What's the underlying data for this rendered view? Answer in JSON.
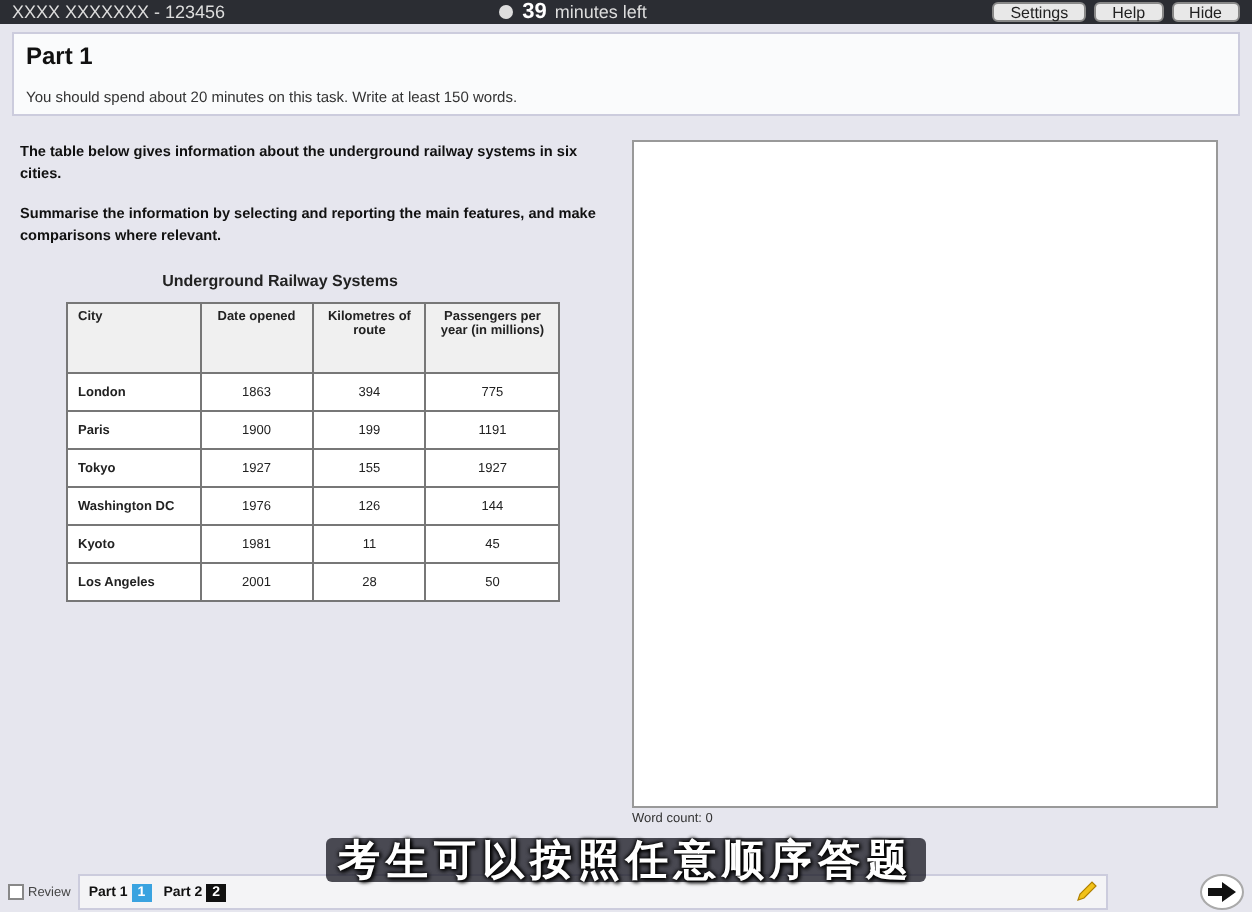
{
  "top_bar": {
    "candidate": "XXXX XXXXXXX - 123456",
    "time_value": "39",
    "time_label": "minutes left",
    "buttons": [
      "Settings",
      "Help",
      "Hide"
    ]
  },
  "header": {
    "title": "Part 1",
    "instruction": "You should spend about 20 minutes on this task. Write at least 150 words."
  },
  "prompt": [
    "The table below gives information about the underground railway systems in six cities.",
    "Summarise the information by selecting and reporting the main features, and make comparisons where relevant."
  ],
  "table": {
    "title": "Underground Railway Systems",
    "columns": [
      "City",
      "Date opened",
      "Kilometres of route",
      "Passengers per year (in millions)"
    ],
    "rows": [
      [
        "London",
        "1863",
        "394",
        "775"
      ],
      [
        "Paris",
        "1900",
        "199",
        "1191"
      ],
      [
        "Tokyo",
        "1927",
        "155",
        "1927"
      ],
      [
        "Washington DC",
        "1976",
        "126",
        "144"
      ],
      [
        "Kyoto",
        "1981",
        "11",
        "45"
      ],
      [
        "Los Angeles",
        "2001",
        "28",
        "50"
      ]
    ]
  },
  "answer": {
    "word_count": "Word count: 0"
  },
  "bottom_bar": {
    "review": {
      "label": "Review",
      "checked": false
    },
    "parts": [
      {
        "label": "Part 1",
        "number": "1",
        "selected": true
      },
      {
        "label": "Part 2",
        "number": "2",
        "selected": false
      }
    ]
  },
  "subtitle": "考生可以按照任意顺序答题"
}
